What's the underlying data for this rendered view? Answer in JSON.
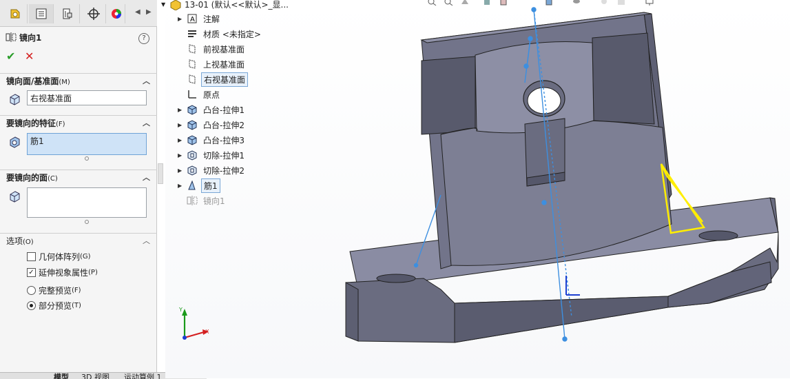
{
  "property_manager": {
    "tabs": [
      "feature-manager-icon",
      "property-manager-icon",
      "configuration-manager-icon",
      "dimxpert-icon",
      "appearance-icon"
    ],
    "title": "镜向1",
    "mirror_plane": {
      "header": "镜向面/基准面",
      "shortcut": "(M)",
      "value": "右视基准面"
    },
    "features_to_mirror": {
      "header": "要镜向的特征",
      "shortcut": "(F)",
      "value": "筋1"
    },
    "faces_to_mirror": {
      "header": "要镜向的面",
      "shortcut": "(C)",
      "value": ""
    },
    "options": {
      "header": "选项",
      "shortcut": "(O)",
      "geometry_pattern": {
        "label": "几何体阵列",
        "shortcut": "(G)",
        "checked": false
      },
      "propagate_visual": {
        "label": "延伸视象属性",
        "shortcut": "(P)",
        "checked": true
      },
      "full_preview": {
        "label": "完整预览",
        "shortcut": "(F)",
        "selected": false
      },
      "partial_preview": {
        "label": "部分预览",
        "shortcut": "(T)",
        "selected": true
      }
    }
  },
  "bottom_tabs": [
    "模型",
    "3D 视图",
    "运动算例 1"
  ],
  "tree": {
    "root": "13-01  (默认<<默认>_显...",
    "items": [
      {
        "label": "注解",
        "icon": "annotation-icon",
        "expandable": true
      },
      {
        "label": "材质 <未指定>",
        "icon": "material-icon",
        "expandable": false
      },
      {
        "label": "前视基准面",
        "icon": "plane-icon",
        "expandable": false
      },
      {
        "label": "上视基准面",
        "icon": "plane-icon",
        "expandable": false
      },
      {
        "label": "右视基准面",
        "icon": "plane-icon",
        "expandable": false,
        "selected": true
      },
      {
        "label": "原点",
        "icon": "origin-icon",
        "expandable": false
      },
      {
        "label": "凸台-拉伸1",
        "icon": "boss-extrude-icon",
        "expandable": true
      },
      {
        "label": "凸台-拉伸2",
        "icon": "boss-extrude-icon",
        "expandable": true
      },
      {
        "label": "凸台-拉伸3",
        "icon": "boss-extrude-icon",
        "expandable": true
      },
      {
        "label": "切除-拉伸1",
        "icon": "cut-extrude-icon",
        "expandable": true
      },
      {
        "label": "切除-拉伸2",
        "icon": "cut-extrude-icon",
        "expandable": true
      },
      {
        "label": "筋1",
        "icon": "rib-icon",
        "expandable": true,
        "selected": true
      },
      {
        "label": "镜向1",
        "icon": "mirror-icon",
        "expandable": false,
        "dim": true
      }
    ]
  },
  "triad": {
    "x": "X",
    "y": "Y"
  },
  "colors": {
    "part": "#7d7f93",
    "preview": "#ffee00",
    "plane": "#3d8fe0",
    "ok": "#2a9d2a",
    "cancel": "#d42020"
  }
}
